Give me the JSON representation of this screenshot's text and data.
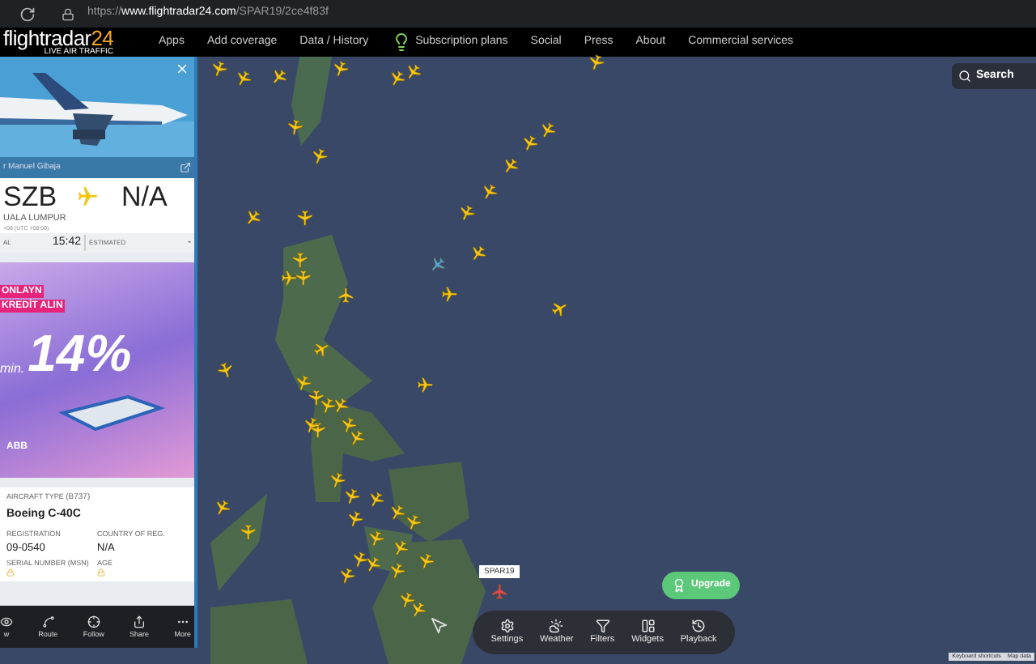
{
  "browser": {
    "url": "https://**www.flightradar24.com**/SPAR19/2ce4f83f"
  },
  "nav": {
    "logo_main": "flightradar",
    "logo_number": "24",
    "tagline": "LIVE AIR TRAFFIC",
    "items": [
      {
        "label": "Apps",
        "kind": "link"
      },
      {
        "label": "Add coverage",
        "kind": "link"
      },
      {
        "label": "Data / History",
        "kind": "link"
      },
      {
        "label": "Subscription plans",
        "kind": "plans"
      },
      {
        "label": "Social",
        "kind": "link"
      },
      {
        "label": "Press",
        "kind": "link"
      },
      {
        "label": "About",
        "kind": "link"
      },
      {
        "label": "Commercial services",
        "kind": "link"
      }
    ]
  },
  "panel": {
    "photo_credit": "r Manuel Gibaja",
    "origin_code": "SZB",
    "dest_code": "N/A",
    "origin_city": "UALA LUMPUR",
    "origin_tz": "+08 (UTC +08:00)",
    "time_label_left": "AL",
    "time_left": "15:42",
    "time_label_right": "ESTIMATED",
    "time_right": "-",
    "ad": {
      "line_1": "ONLAYN",
      "line_2": "KREDİT ALIN",
      "prefix": "min.",
      "rate": "14%",
      "brand": "ABB"
    },
    "aircraft_type_label": "AIRCRAFT TYPE",
    "aircraft_type_code": "(B737)",
    "aircraft_type": "Boeing C-40C",
    "details": [
      {
        "label": "REGISTRATION",
        "value": "09-0540",
        "locked": false
      },
      {
        "label": "COUNTRY OF REG.",
        "value": "N/A",
        "locked": false
      },
      {
        "label": "SERIAL NUMBER (MSN)",
        "locked": true
      },
      {
        "label": "AGE",
        "locked": true
      }
    ],
    "toolbar": [
      {
        "label": "w",
        "kind": "view"
      },
      {
        "label": "Route",
        "kind": "route"
      },
      {
        "label": "Follow",
        "kind": "follow"
      },
      {
        "label": "Share",
        "kind": "share"
      },
      {
        "label": "More",
        "kind": "more"
      }
    ]
  },
  "map": {
    "search": "Search",
    "callsign": "SPAR19",
    "upgrade": "Upgrade",
    "tools": [
      {
        "label": "Settings",
        "kind": "settings"
      },
      {
        "label": "Weather",
        "kind": "weather"
      },
      {
        "label": "Filters",
        "kind": "filters"
      },
      {
        "label": "Widgets",
        "kind": "widgets"
      },
      {
        "label": "Playback",
        "kind": "playback"
      }
    ],
    "attribution": [
      "Keyboard shortcuts",
      "Map data"
    ]
  }
}
